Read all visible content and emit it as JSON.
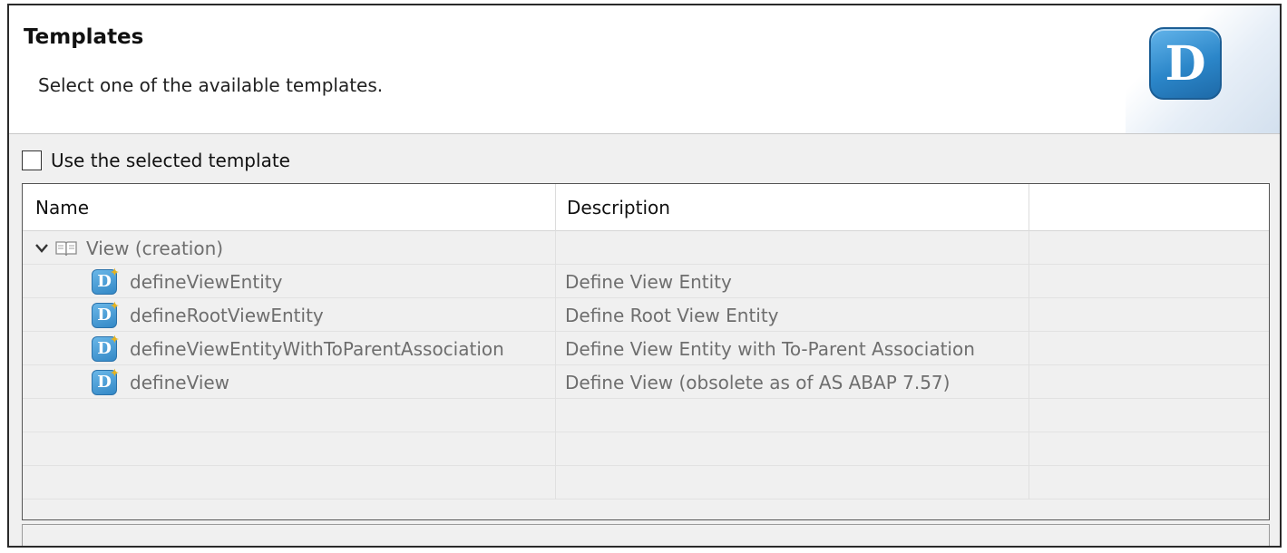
{
  "header": {
    "title": "Templates",
    "description": "Select one of the available templates.",
    "logo_letter": "D"
  },
  "use_template": {
    "label": "Use the selected template",
    "checked": false
  },
  "table": {
    "columns": [
      "Name",
      "Description",
      ""
    ],
    "group": {
      "label": "View (creation)",
      "expanded": true
    },
    "rows": [
      {
        "name": "defineViewEntity",
        "description": "Define View Entity"
      },
      {
        "name": "defineRootViewEntity",
        "description": "Define Root View Entity"
      },
      {
        "name": "defineViewEntityWithToParentAssociation",
        "description": "Define View Entity with To-Parent Association"
      },
      {
        "name": "defineView",
        "description": "Define View (obsolete as of AS ABAP 7.57)"
      }
    ],
    "template_icon_letter": "D",
    "template_icon_badge": "✦"
  },
  "icons": {
    "group_toggle": "chevron-down-icon",
    "group_icon": "book-icon",
    "template_icon": "ddl-template-icon"
  },
  "colors": {
    "accent": "#2b86c9",
    "row_text": "#6e6e6e"
  }
}
